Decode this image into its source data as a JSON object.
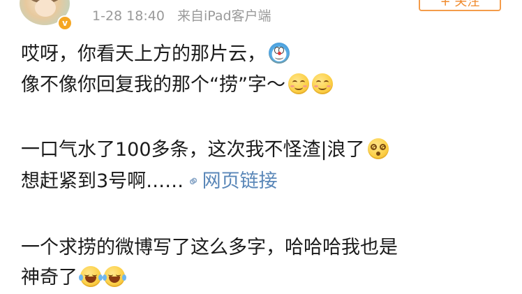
{
  "header": {
    "timestamp": "1-28 18:40",
    "source": "来自iPad客户端",
    "follow_label": "+ 关注"
  },
  "post": {
    "line1": "哎呀，你看天上方的那片云，",
    "line2": "像不像你回复我的那个“捞”字～",
    "line3": "一口气水了100多条，这次我不怪渣|浪了",
    "line4_text": "想赶紧到3号啊……",
    "link_label": "网页链接",
    "line5": "一个求捞的微博写了这么多字，哈哈哈我也是",
    "line6": "神奇了"
  },
  "icons": {
    "verified": "verified-badge-icon",
    "link": "link-icon",
    "emoji_doraemon": "doraemon-emoji-icon",
    "emoji_smile": "smile-emoji-icon",
    "emoji_dizzy": "dizzy-emoji-icon",
    "emoji_laugh_cry": "laugh-cry-emoji-icon"
  },
  "colors": {
    "link": "#5a87b8",
    "meta": "#9a9a9a",
    "follow_border": "#f49c4a",
    "text": "#1b1b1b"
  }
}
